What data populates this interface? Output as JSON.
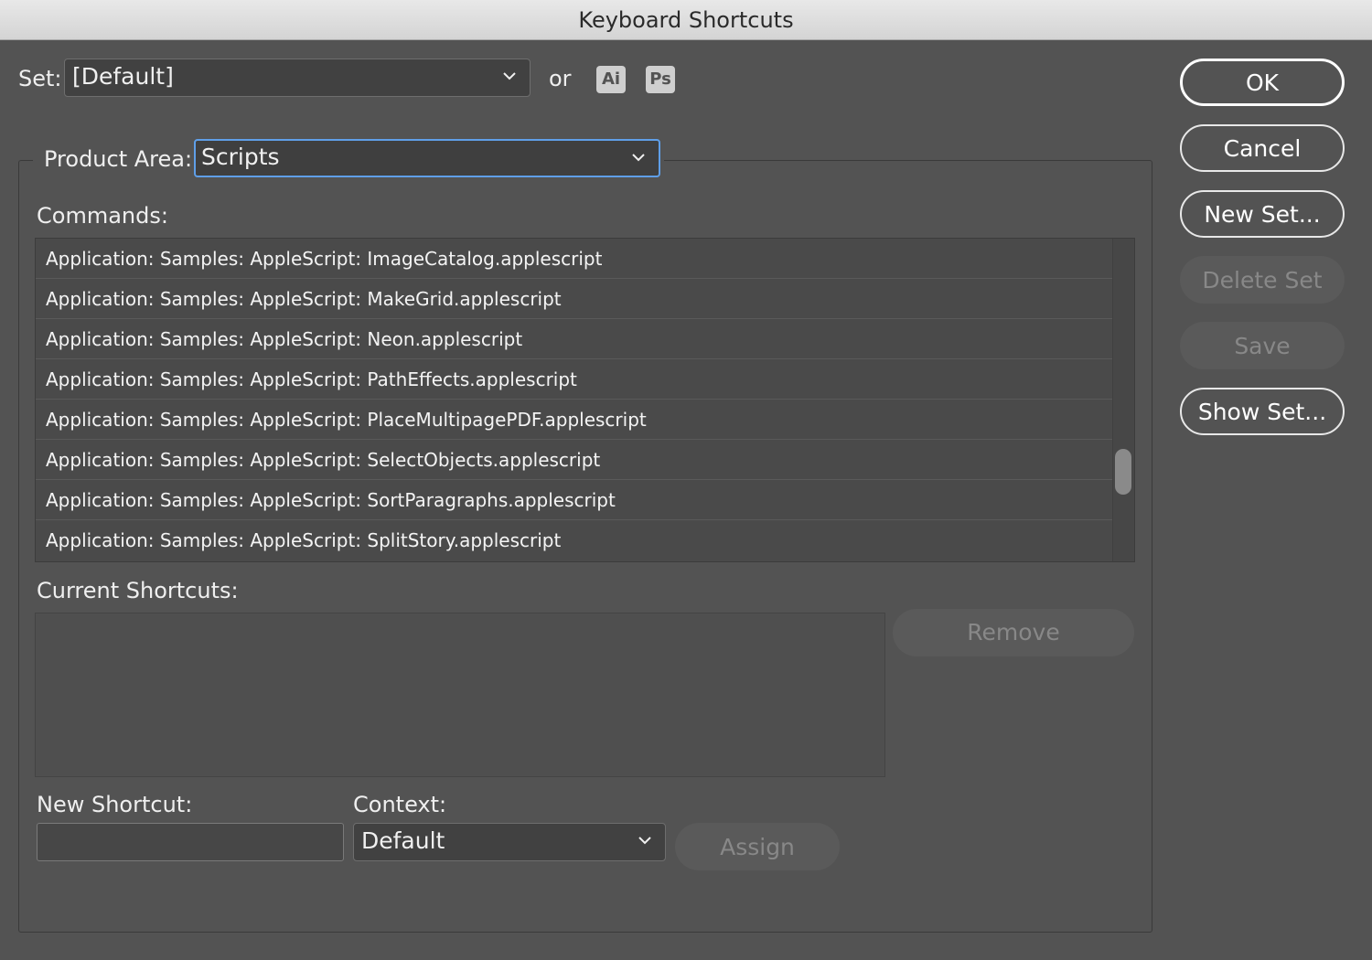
{
  "window": {
    "title": "Keyboard Shortcuts"
  },
  "set": {
    "label": "Set:",
    "value": "[Default]",
    "or_label": "or",
    "app_badges": [
      "Ai",
      "Ps"
    ]
  },
  "product_area": {
    "label": "Product Area:",
    "value": "Scripts"
  },
  "commands": {
    "label": "Commands:",
    "items": [
      "Application: Samples: AppleScript: ImageCatalog.applescript",
      "Application: Samples: AppleScript: MakeGrid.applescript",
      "Application: Samples: AppleScript: Neon.applescript",
      "Application: Samples: AppleScript: PathEffects.applescript",
      "Application: Samples: AppleScript: PlaceMultipagePDF.applescript",
      "Application: Samples: AppleScript: SelectObjects.applescript",
      "Application: Samples: AppleScript: SortParagraphs.applescript",
      "Application: Samples: AppleScript: SplitStory.applescript"
    ]
  },
  "current_shortcuts": {
    "label": "Current Shortcuts:",
    "remove_label": "Remove"
  },
  "new_shortcut": {
    "label": "New Shortcut:",
    "value": ""
  },
  "context": {
    "label": "Context:",
    "value": "Default"
  },
  "assign_label": "Assign",
  "buttons": {
    "ok": "OK",
    "cancel": "Cancel",
    "new_set": "New Set...",
    "delete_set": "Delete Set",
    "save": "Save",
    "show_set": "Show Set..."
  },
  "icons": {
    "dropdown": "chevron-down-icon"
  },
  "colors": {
    "dialog_bg": "#535353",
    "focus_ring": "#5f9fe8",
    "disabled_text": "#888888"
  }
}
